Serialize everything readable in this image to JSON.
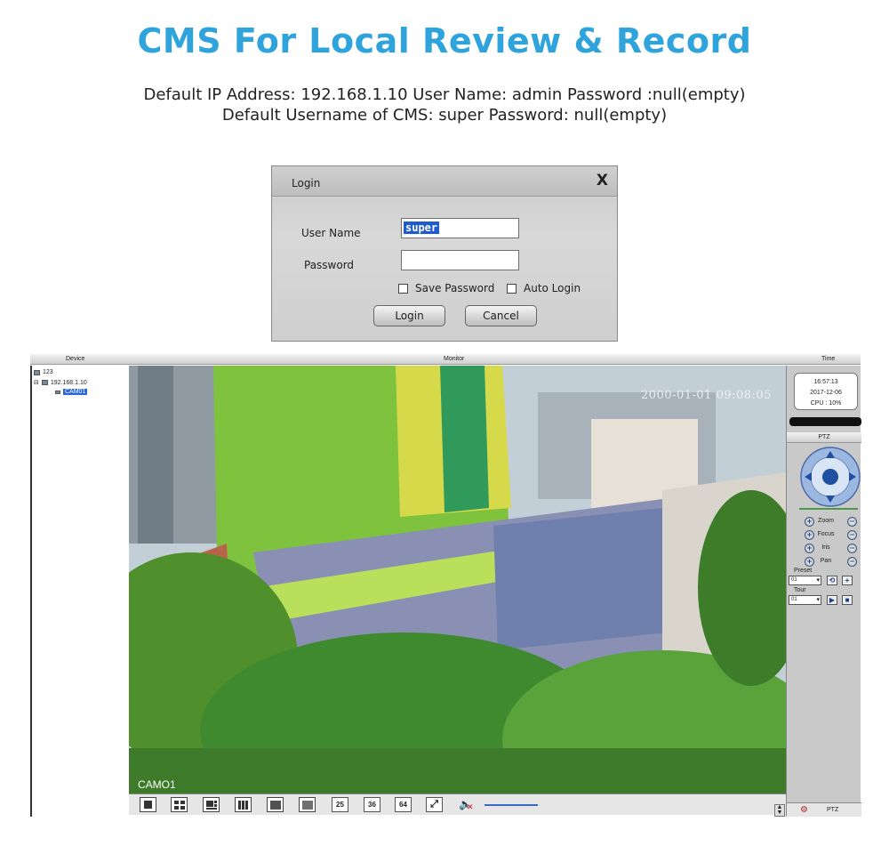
{
  "heading": {
    "title": "CMS For Local Review & Record",
    "info_line_1": "Default IP Address: 192.168.1.10  User Name: admin  Password :null(empty)",
    "info_line_2": "Default Username of CMS: super Password: null(empty)",
    "title_color": "#2fa3dc"
  },
  "login_dialog": {
    "title": "Login",
    "close_label": "X",
    "user_name_label": "User Name",
    "password_label": "Password",
    "user_name_value": "super",
    "password_value": "",
    "save_password_label": "Save Password",
    "auto_login_label": "Auto Login",
    "login_button": "Login",
    "cancel_button": "Cancel"
  },
  "cms": {
    "header": {
      "device": "Device",
      "monitor": "Monitor",
      "time": "Time"
    },
    "device_tree": {
      "root": "123",
      "device": "192.168.1.10",
      "camera": "CAM01"
    },
    "video": {
      "osd_timestamp": "2000-01-01 09:08:05",
      "camera_label": "CAMO1"
    },
    "toolbar": {
      "layouts": [
        "1",
        "4",
        "6",
        "8",
        "9",
        "16",
        "25",
        "36",
        "64"
      ],
      "fullscreen_icon": "fullscreen-icon",
      "volume_icon": "speaker-muted-icon"
    },
    "clock": {
      "time": "16:57:13",
      "date": "2017-12-06",
      "cpu": "CPU : 10%"
    },
    "ptz": {
      "title": "PTZ",
      "controls": [
        "Zoom",
        "Focus",
        "Iris",
        "Pan"
      ],
      "preset_label": "Preset",
      "preset_value": "01",
      "tour_label": "Tour",
      "tour_value": "01",
      "footer_label": "PTZ"
    }
  }
}
